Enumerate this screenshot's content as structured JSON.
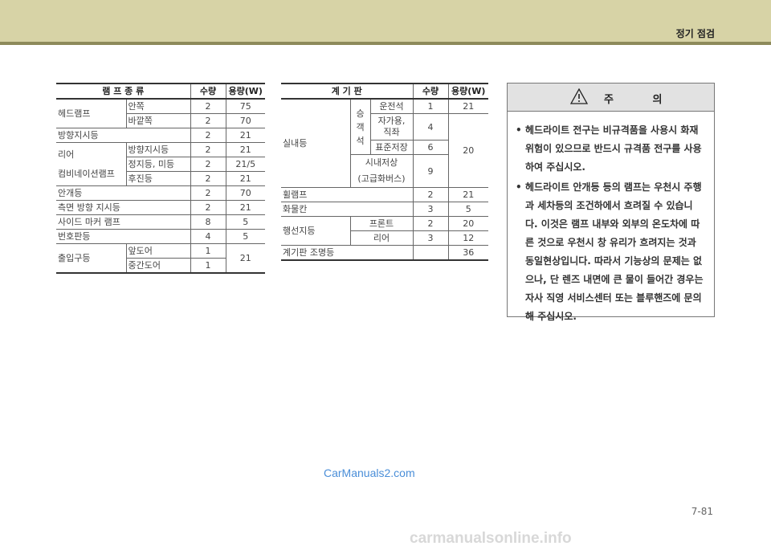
{
  "header": {
    "section_title": "정기 점검"
  },
  "lamp_table": {
    "h_type": "램 프 종 류",
    "h_qty": "수량",
    "h_watt": "용량(W)",
    "headlamp": "헤드램프",
    "headlamp_inner": "안쪽",
    "headlamp_inner_qty": "2",
    "headlamp_inner_w": "75",
    "headlamp_outer": "바깥쪽",
    "headlamp_outer_qty": "2",
    "headlamp_outer_w": "70",
    "turn_signal": "방향지시등",
    "turn_signal_qty": "2",
    "turn_signal_w": "21",
    "rear_combo": [
      "리어",
      "컴비네이션램프"
    ],
    "rc_turn": "방향지시등",
    "rc_turn_qty": "2",
    "rc_turn_w": "21",
    "rc_stop": "정지등, 미등",
    "rc_stop_qty": "2",
    "rc_stop_w": "21/5",
    "rc_reverse": "후진등",
    "rc_reverse_qty": "2",
    "rc_reverse_w": "21",
    "fog": "안개등",
    "fog_qty": "2",
    "fog_w": "70",
    "side_repeater": "측면 방향 지시등",
    "side_repeater_qty": "2",
    "side_repeater_w": "21",
    "side_marker": "사이드 마커 램프",
    "side_marker_qty": "8",
    "side_marker_w": "5",
    "plate": "번호판등",
    "plate_qty": "4",
    "plate_w": "5",
    "door": "출입구등",
    "door_front": "앞도어",
    "door_front_qty": "1",
    "door_middle": "중간도어",
    "door_middle_qty": "1",
    "door_w": "21"
  },
  "instrument_table": {
    "h_type": "계 기 판",
    "h_qty": "수량",
    "h_watt": "용량(W)",
    "interior": "실내등",
    "passenger": [
      "승",
      "객",
      "석"
    ],
    "driver_seat": "운전석",
    "driver_seat_qty": "1",
    "driver_seat_w": "21",
    "self_seat": [
      "자가용,",
      "직좌"
    ],
    "self_seat_qty": "4",
    "standard": "표준저장",
    "standard_qty": "6",
    "interior_w": "20",
    "sinaejeo": [
      "시내저상",
      "(고급화버스)"
    ],
    "sinaejeo_qty": "9",
    "wheelchair": "휠램프",
    "wheelchair_qty": "2",
    "wheelchair_w": "21",
    "cargo": "화물칸",
    "cargo_qty": "3",
    "cargo_w": "5",
    "destination": "행선지등",
    "dest_front": "프론트",
    "dest_front_qty": "2",
    "dest_front_w": "20",
    "dest_rear": "리어",
    "dest_rear_qty": "3",
    "dest_rear_w": "12",
    "cluster": "계기판 조명등",
    "cluster_w": "36"
  },
  "caution": {
    "title": "주 의",
    "items": [
      "헤드라이트 전구는 비규격품을 사용시 화재위험이 있으므로 반드시 규격품 전구를 사용하여 주십시오.",
      "헤드라이트 안개등 등의 램프는 우천시 주행과 세차등의 조건하에서 흐려질 수 있습니다. 이것은 램프 내부와 외부의 온도차에 따른 것으로 우천시 창 유리가 흐려지는 것과 동일현상입니다. 따라서 기능상의 문제는 없으나, 단 렌즈 내면에 큰 물이 들어간 경우는 자사 직영 서비스센터 또는 블루핸즈에 문의해 주십시오."
    ]
  },
  "watermark": "CarManuals2.com",
  "page_number": "7-81",
  "footer_watermark": "carmanualsonline.info",
  "icons": {
    "caution": "warning-triangle-icon"
  }
}
